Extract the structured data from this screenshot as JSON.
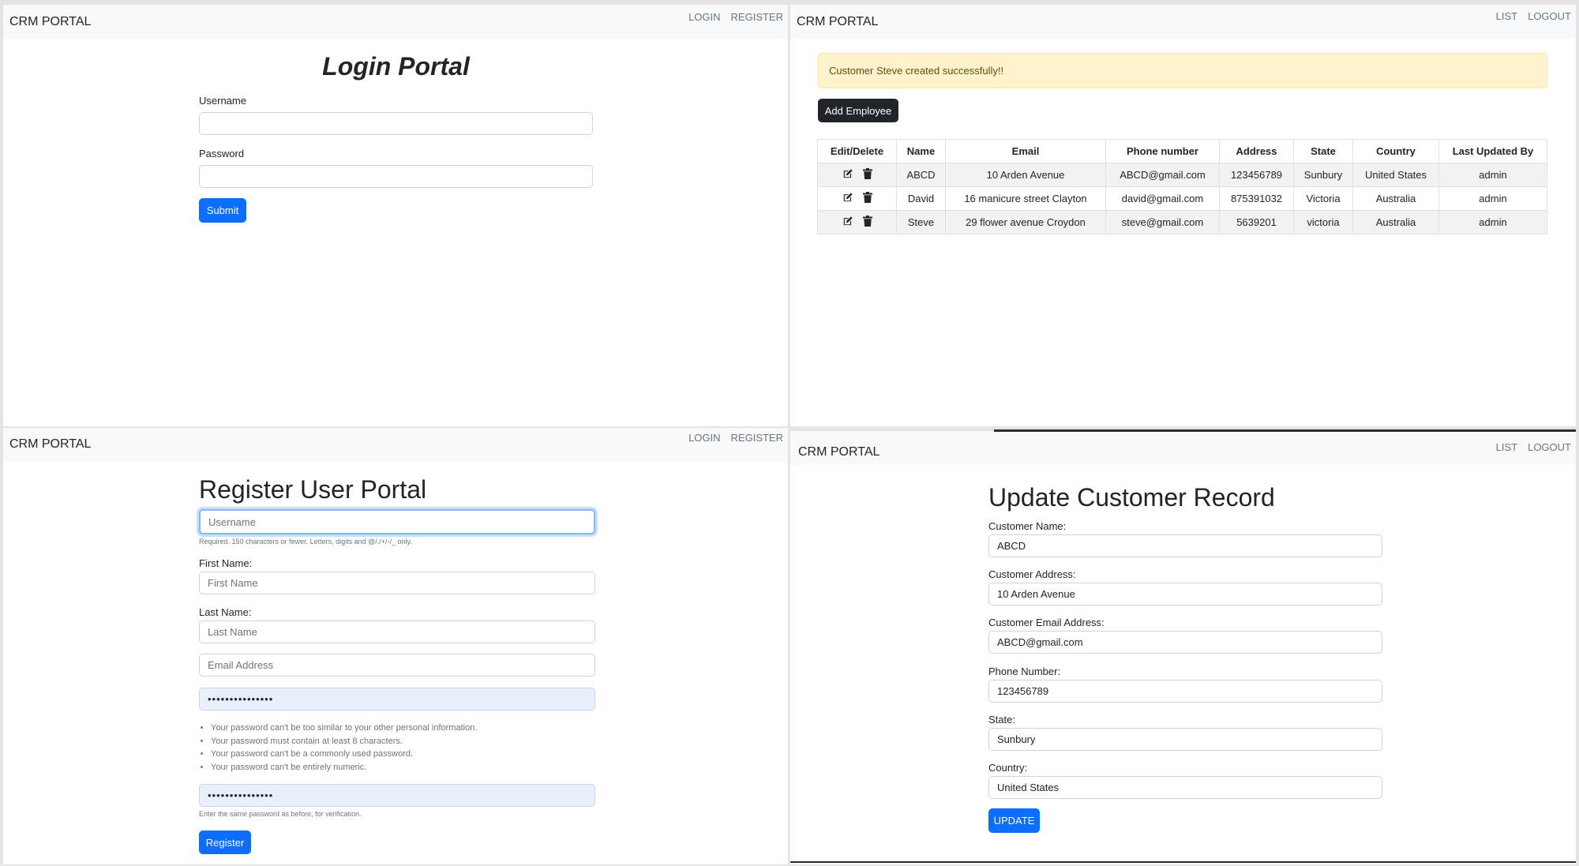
{
  "brand": "CRM PORTAL",
  "login": {
    "nav": [
      "LOGIN",
      "REGISTER"
    ],
    "title": "Login Portal",
    "username_label": "Username",
    "password_label": "Password",
    "submit_label": "Submit"
  },
  "list": {
    "nav": [
      "LIST",
      "LOGOUT"
    ],
    "alert": "Customer Steve created successfully!!",
    "add_button": "Add Employee",
    "columns": [
      "Edit/Delete",
      "Name",
      "Email",
      "Phone number",
      "Address",
      "State",
      "Country",
      "Last Updated By"
    ],
    "rows": [
      {
        "name": "ABCD",
        "email": "10 Arden Avenue",
        "phone": "ABCD@gmail.com",
        "address": "123456789",
        "state": "Sunbury",
        "country": "United States",
        "updated_by": "admin"
      },
      {
        "name": "David",
        "email": "16 manicure street Clayton",
        "phone": "david@gmail.com",
        "address": "875391032",
        "state": "Victoria",
        "country": "Australia",
        "updated_by": "admin"
      },
      {
        "name": "Steve",
        "email": "29 flower avenue Croydon",
        "phone": "steve@gmail.com",
        "address": "5639201",
        "state": "victoria",
        "country": "Australia",
        "updated_by": "admin"
      }
    ],
    "icons": [
      "edit-icon",
      "trash-icon"
    ]
  },
  "register": {
    "nav": [
      "LOGIN",
      "REGISTER"
    ],
    "title": "Register User Portal",
    "username_placeholder": "Username",
    "username_help": "Required. 150 characters or fewer. Letters, digits and @/./+/-/_ only.",
    "first_name_label": "First Name:",
    "first_name_placeholder": "First Name",
    "last_name_label": "Last Name:",
    "last_name_placeholder": "Last Name",
    "email_placeholder": "Email Address",
    "password_value": "•••••••••••••••",
    "password_rules": [
      "Your password can't be too similar to your other personal information.",
      "Your password must contain at least 8 characters.",
      "Your password can't be a commonly used password.",
      "Your password can't be entirely numeric."
    ],
    "password2_value": "•••••••••••••••",
    "password2_help": "Enter the same password as before, for verification.",
    "register_label": "Register"
  },
  "update": {
    "nav": [
      "LIST",
      "LOGOUT"
    ],
    "title": "Update Customer Record",
    "fields": [
      {
        "label": "Customer Name:",
        "value": "ABCD"
      },
      {
        "label": "Customer Address:",
        "value": "10 Arden Avenue"
      },
      {
        "label": "Customer Email Address:",
        "value": "ABCD@gmail.com"
      },
      {
        "label": "Phone Number:",
        "value": "123456789"
      },
      {
        "label": "State:",
        "value": "Sunbury"
      },
      {
        "label": "Country:",
        "value": "United States"
      }
    ],
    "update_label": "UPDATE"
  }
}
